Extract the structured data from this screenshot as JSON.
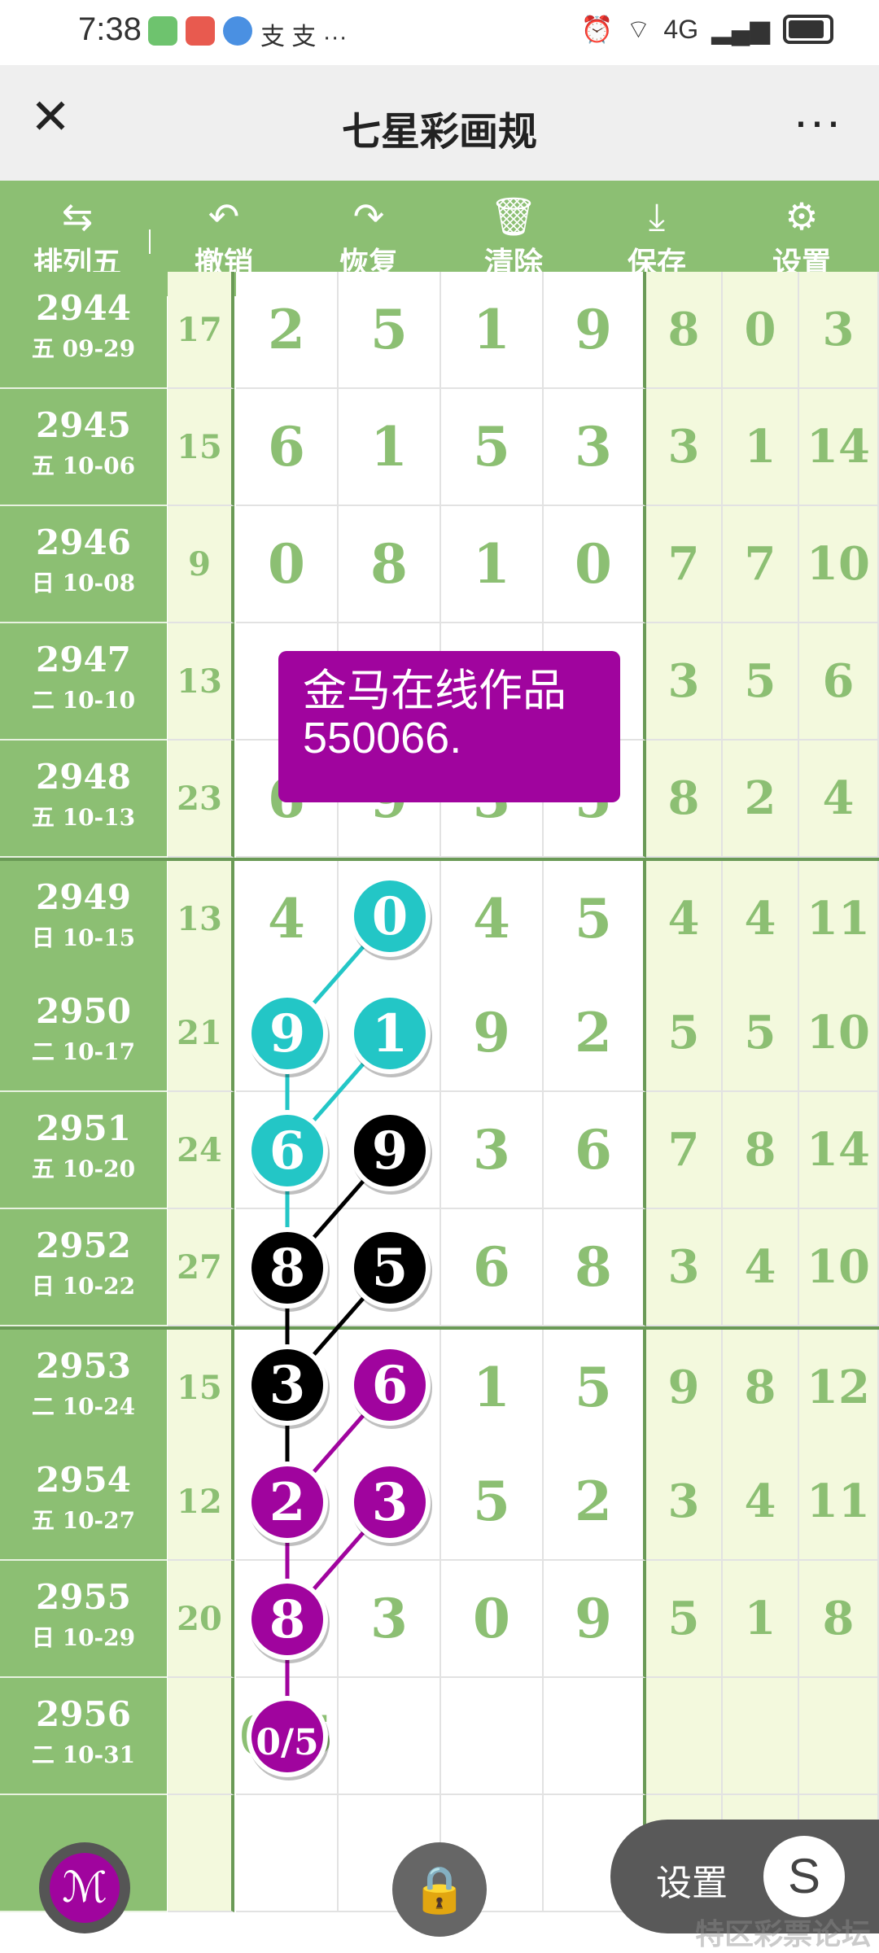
{
  "status": {
    "time": "7:38",
    "notif_text": "支 支 ···",
    "net": "4G"
  },
  "header": {
    "title": "七星彩画规",
    "close": "✕",
    "more": "···"
  },
  "toolbar": [
    {
      "label": "排列五",
      "icon": "swap-icon"
    },
    {
      "label": "撤销",
      "icon": "undo-icon"
    },
    {
      "label": "恢复",
      "icon": "redo-icon"
    },
    {
      "label": "清除",
      "icon": "trash-icon"
    },
    {
      "label": "保存",
      "icon": "download-icon"
    },
    {
      "label": "设置",
      "icon": "gear-icon"
    }
  ],
  "rows": [
    {
      "issue": "2944",
      "date": "五 09-29",
      "sum": "17",
      "digits": [
        "2",
        "5",
        "1",
        "9"
      ],
      "extra": [
        "8",
        "0",
        "3"
      ]
    },
    {
      "issue": "2945",
      "date": "五 10-06",
      "sum": "15",
      "digits": [
        "6",
        "1",
        "5",
        "3"
      ],
      "extra": [
        "3",
        "1",
        "14"
      ]
    },
    {
      "issue": "2946",
      "date": "日 10-08",
      "sum": "9",
      "digits": [
        "0",
        "8",
        "1",
        "0"
      ],
      "extra": [
        "7",
        "7",
        "10"
      ]
    },
    {
      "issue": "2947",
      "date": "二 10-10",
      "sum": "13",
      "digits": [
        "",
        "",
        "",
        ""
      ],
      "extra": [
        "3",
        "5",
        "6"
      ]
    },
    {
      "issue": "2948",
      "date": "五 10-13",
      "sum": "23",
      "digits": [
        "6",
        "9",
        "3",
        "5"
      ],
      "extra": [
        "8",
        "2",
        "4"
      ]
    },
    {
      "issue": "2949",
      "date": "日 10-15",
      "sum": "13",
      "digits": [
        "4",
        "0",
        "4",
        "5"
      ],
      "extra": [
        "4",
        "4",
        "11"
      ]
    },
    {
      "issue": "2950",
      "date": "二 10-17",
      "sum": "21",
      "digits": [
        "9",
        "1",
        "9",
        "2"
      ],
      "extra": [
        "5",
        "5",
        "10"
      ]
    },
    {
      "issue": "2951",
      "date": "五 10-20",
      "sum": "24",
      "digits": [
        "6",
        "9",
        "3",
        "6"
      ],
      "extra": [
        "7",
        "8",
        "14"
      ]
    },
    {
      "issue": "2952",
      "date": "日 10-22",
      "sum": "27",
      "digits": [
        "8",
        "5",
        "6",
        "8"
      ],
      "extra": [
        "3",
        "4",
        "10"
      ]
    },
    {
      "issue": "2953",
      "date": "二 10-24",
      "sum": "15",
      "digits": [
        "3",
        "6",
        "1",
        "5"
      ],
      "extra": [
        "9",
        "8",
        "12"
      ]
    },
    {
      "issue": "2954",
      "date": "五 10-27",
      "sum": "12",
      "digits": [
        "2",
        "3",
        "5",
        "2"
      ],
      "extra": [
        "3",
        "4",
        "11"
      ]
    },
    {
      "issue": "2955",
      "date": "日 10-29",
      "sum": "20",
      "digits": [
        "8",
        "3",
        "0",
        "9"
      ],
      "extra": [
        "5",
        "1",
        "8"
      ]
    },
    {
      "issue": "2956",
      "date": "二 10-31",
      "sum": "",
      "digits": [
        "0/5",
        "",
        "",
        ""
      ],
      "extra": [
        "",
        "",
        ""
      ]
    },
    {
      "issue": "",
      "date": "",
      "sum": "",
      "digits": [
        "",
        "",
        "",
        ""
      ],
      "extra": [
        "",
        "",
        ""
      ]
    }
  ],
  "balls": [
    {
      "row": 5,
      "col": 1,
      "value": "0",
      "color": "#23c6c6"
    },
    {
      "row": 6,
      "col": 0,
      "value": "9",
      "color": "#23c6c6"
    },
    {
      "row": 6,
      "col": 1,
      "value": "1",
      "color": "#23c6c6"
    },
    {
      "row": 7,
      "col": 0,
      "value": "6",
      "color": "#23c6c6"
    },
    {
      "row": 7,
      "col": 1,
      "value": "9",
      "color": "#000000"
    },
    {
      "row": 8,
      "col": 0,
      "value": "8",
      "color": "#000000"
    },
    {
      "row": 8,
      "col": 1,
      "value": "5",
      "color": "#000000"
    },
    {
      "row": 9,
      "col": 0,
      "value": "3",
      "color": "#000000"
    },
    {
      "row": 9,
      "col": 1,
      "value": "6",
      "color": "#a0049e"
    },
    {
      "row": 10,
      "col": 0,
      "value": "2",
      "color": "#a0049e"
    },
    {
      "row": 10,
      "col": 1,
      "value": "3",
      "color": "#a0049e"
    },
    {
      "row": 11,
      "col": 0,
      "value": "8",
      "color": "#a0049e"
    },
    {
      "row": 12,
      "col": 0,
      "value": "0/5",
      "color": "#a0049e"
    }
  ],
  "links": [
    {
      "from": [
        5,
        1
      ],
      "to": [
        6,
        0
      ],
      "color": "#23c6c6"
    },
    {
      "from": [
        6,
        0
      ],
      "to": [
        7,
        0
      ],
      "color": "#23c6c6"
    },
    {
      "from": [
        6,
        1
      ],
      "to": [
        7,
        0
      ],
      "color": "#23c6c6"
    },
    {
      "from": [
        7,
        0
      ],
      "to": [
        8,
        0
      ],
      "color": "#23c6c6"
    },
    {
      "from": [
        7,
        1
      ],
      "to": [
        8,
        0
      ],
      "color": "#000000"
    },
    {
      "from": [
        8,
        0
      ],
      "to": [
        9,
        0
      ],
      "color": "#000000"
    },
    {
      "from": [
        8,
        1
      ],
      "to": [
        9,
        0
      ],
      "color": "#000000"
    },
    {
      "from": [
        9,
        0
      ],
      "to": [
        10,
        0
      ],
      "color": "#000000"
    },
    {
      "from": [
        9,
        1
      ],
      "to": [
        10,
        0
      ],
      "color": "#a0049e"
    },
    {
      "from": [
        10,
        0
      ],
      "to": [
        11,
        0
      ],
      "color": "#a0049e"
    },
    {
      "from": [
        10,
        1
      ],
      "to": [
        11,
        0
      ],
      "color": "#a0049e"
    },
    {
      "from": [
        11,
        0
      ],
      "to": [
        12,
        0
      ],
      "color": "#a0049e"
    }
  ],
  "note": {
    "line1": "金马在线作品",
    "line2": "550066."
  },
  "floating": {
    "settings_label": "设置",
    "s_glyph": "S",
    "brush_glyph": "ℳ",
    "lock_glyph": "🔒"
  },
  "watermark": "特区彩票论坛",
  "colors": {
    "green": "#8cbf73",
    "cyan": "#23c6c6",
    "purple": "#a0049e",
    "cream": "#f3f9dd"
  }
}
